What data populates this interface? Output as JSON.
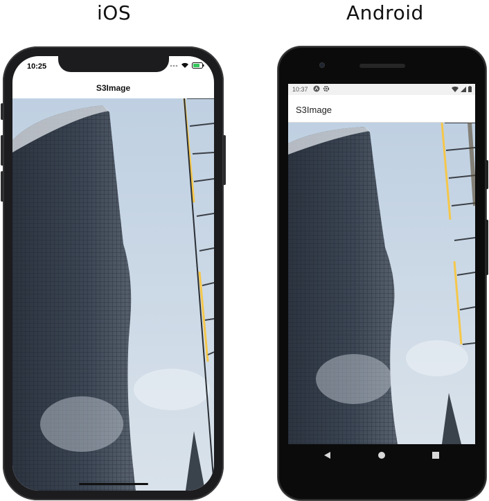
{
  "headings": {
    "ios": "iOS",
    "android": "Android"
  },
  "ios": {
    "status_time": "10:25",
    "nav_title": "S3Image",
    "photo_icon": "building-photo"
  },
  "android": {
    "status_time": "10:37",
    "app_title": "S3Image",
    "photo_icon": "building-photo",
    "nav_icons": [
      "back-triangle-icon",
      "home-circle-icon",
      "recents-square-icon"
    ]
  },
  "colors": {
    "device_ios": "#1c1c1e",
    "device_android": "#0b0b0b",
    "sky": "#c9d6e3",
    "battery_green": "#34c759"
  }
}
